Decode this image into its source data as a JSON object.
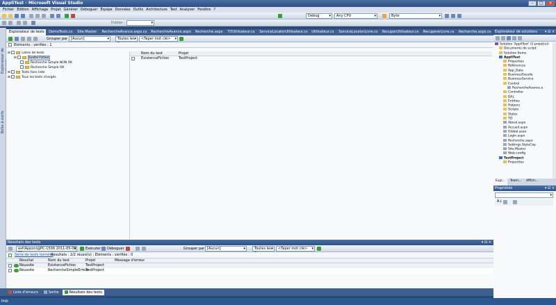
{
  "window": {
    "title": "AppliTest - Microsoft Visual Studio"
  },
  "menu": [
    "Fichier",
    "Edition",
    "Affichage",
    "Projet",
    "Générer",
    "Déboguer",
    "Équipe",
    "Données",
    "Outils",
    "Architecture",
    "Test",
    "Analyser",
    "Fenêtre",
    "?"
  ],
  "toolbar": {
    "config": "Debug",
    "platform": "Any CPU",
    "find": "Byte",
    "publish": "Publier :"
  },
  "doc_tabs": [
    "Explorateur de tests",
    "DemoTests.cs",
    "Site.Master",
    "RechercheAvance.aspx.cs",
    "RechercheAvance.aspx",
    "Recherche.aspx",
    "TOUtilisateur.cs",
    "ServiceLocatorUtilisateur.cs",
    "Utilisateur.cs",
    "ServiceLocatorLivre.cs",
    "RecuperUtilisateur.cs",
    "RecupererLivre.cs",
    "Recherche.aspx.cs"
  ],
  "left_strip": {
    "items": [
      "Explorateur de serveurs",
      "Boîte à outils"
    ]
  },
  "test_explorer": {
    "group_by_label": "Grouper par :",
    "group_by_value": "[Aucun]",
    "columns_value": "Toutes les c",
    "search_placeholder": "<Taper mot clé>",
    "status": "Éléments : vérifiés : 1",
    "tree": [
      {
        "label": "Listes de tests",
        "level": 0
      },
      {
        "label": "Existe Fichier",
        "level": 1
      },
      {
        "label": "Recherche Simple NON OK",
        "level": 2
      },
      {
        "label": "Recherche Simple OK",
        "level": 2
      },
      {
        "label": "Tests hors liste",
        "level": 0
      },
      {
        "label": "Tous les tests chargés",
        "level": 0
      }
    ],
    "grid_headers": [
      "Nom du test",
      "Projet"
    ],
    "grid_rows": [
      {
        "name": "ExistenceFichier",
        "project": "TestProject"
      }
    ]
  },
  "results": {
    "title": "Résultats des tests",
    "run_value": "ext\\Apponi@PC-1506 2011-05-09 11:",
    "execute_label": "Exécuter",
    "debug_label": "Déboguer",
    "group_by_label": "Grouper par :",
    "group_by_value": "[Aucun]",
    "columns_value": "Toutes les c",
    "search_placeholder": "<Taper mot clé>",
    "summary_link": "Série de tests terminé",
    "summary_text": "Résultats : 2/2 réussi(s) ; Éléments : vérifiés : 0",
    "headers": [
      "Résultat",
      "Nom du test",
      "Projet",
      "Message d'erreur"
    ],
    "rows": [
      {
        "result": "Réussite",
        "name": "ExistenceFichier",
        "project": "TestProject",
        "message": ""
      },
      {
        "result": "Réussite",
        "name": "RechercheSimpleErreur",
        "project": "TestProject",
        "message": ""
      }
    ]
  },
  "solution_explorer": {
    "title": "Explorateur de solutions",
    "items": [
      {
        "label": "Solution 'AppliTest' (2 projet(s))",
        "level": 0,
        "icon": "solution"
      },
      {
        "label": "Documents de script",
        "level": 1,
        "icon": "folder"
      },
      {
        "label": "Solution Items",
        "level": 1,
        "icon": "folder"
      },
      {
        "label": "AppliTest",
        "level": 1,
        "icon": "project"
      },
      {
        "label": "Properties",
        "level": 2,
        "icon": "folder"
      },
      {
        "label": "Références",
        "level": 2,
        "icon": "folder"
      },
      {
        "label": "App_Data",
        "level": 2,
        "icon": "folder"
      },
      {
        "label": "BusinessFacade",
        "level": 2,
        "icon": "folder"
      },
      {
        "label": "BusinessService",
        "level": 2,
        "icon": "folder"
      },
      {
        "label": "Control",
        "level": 2,
        "icon": "folder"
      },
      {
        "label": "RechercheAvance.a",
        "level": 3,
        "icon": "file"
      },
      {
        "label": "Controller",
        "level": 2,
        "icon": "folder"
      },
      {
        "label": "DAL",
        "level": 2,
        "icon": "folder"
      },
      {
        "label": "Entities",
        "level": 2,
        "icon": "folder"
      },
      {
        "label": "Helpers",
        "level": 2,
        "icon": "folder"
      },
      {
        "label": "Scripts",
        "level": 2,
        "icon": "folder"
      },
      {
        "label": "Styles",
        "level": 2,
        "icon": "folder"
      },
      {
        "label": "TO",
        "level": 2,
        "icon": "folder"
      },
      {
        "label": "About.aspx",
        "level": 2,
        "icon": "file"
      },
      {
        "label": "Accueil.aspx",
        "level": 2,
        "icon": "file"
      },
      {
        "label": "Global.asax",
        "level": 2,
        "icon": "file"
      },
      {
        "label": "Login.aspx",
        "level": 2,
        "icon": "file"
      },
      {
        "label": "Recherche.aspx",
        "level": 2,
        "icon": "file"
      },
      {
        "label": "Settings.StyleCop",
        "level": 2,
        "icon": "file"
      },
      {
        "label": "Site.Master",
        "level": 2,
        "icon": "file"
      },
      {
        "label": "Web.config",
        "level": 2,
        "icon": "file"
      },
      {
        "label": "TestProject",
        "level": 1,
        "icon": "project"
      },
      {
        "label": "Properties",
        "level": 2,
        "icon": "folder"
      }
    ],
    "tabs": [
      "Expl...",
      "Team...",
      "Affich..."
    ]
  },
  "properties": {
    "title": "Propriétés"
  },
  "bottom_tabs": [
    "Liste d'erreurs",
    "Sortie",
    "Résultats des tests"
  ],
  "status": "Prêt"
}
